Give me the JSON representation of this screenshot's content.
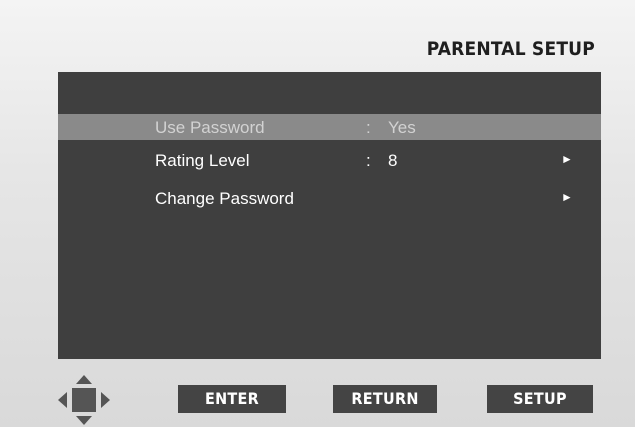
{
  "title": "PARENTAL SETUP",
  "menu": [
    {
      "label": "Use Password",
      "value": "Yes",
      "selected": true,
      "has_submenu": false
    },
    {
      "label": "Rating Level",
      "value": "8",
      "selected": false,
      "has_submenu": true
    },
    {
      "label": "Change Password",
      "value": "",
      "selected": false,
      "has_submenu": true
    }
  ],
  "colon": ":",
  "arrow_glyph": "►",
  "buttons": {
    "enter": "ENTER",
    "return": "RETURN",
    "setup": "SETUP"
  },
  "icons": {
    "navigation": "dpad-arrows-icon",
    "submenu": "triangle-right-icon"
  },
  "colors": {
    "panel": "#3f3f3f",
    "highlight": "#8a8a8a",
    "button": "#444444"
  }
}
